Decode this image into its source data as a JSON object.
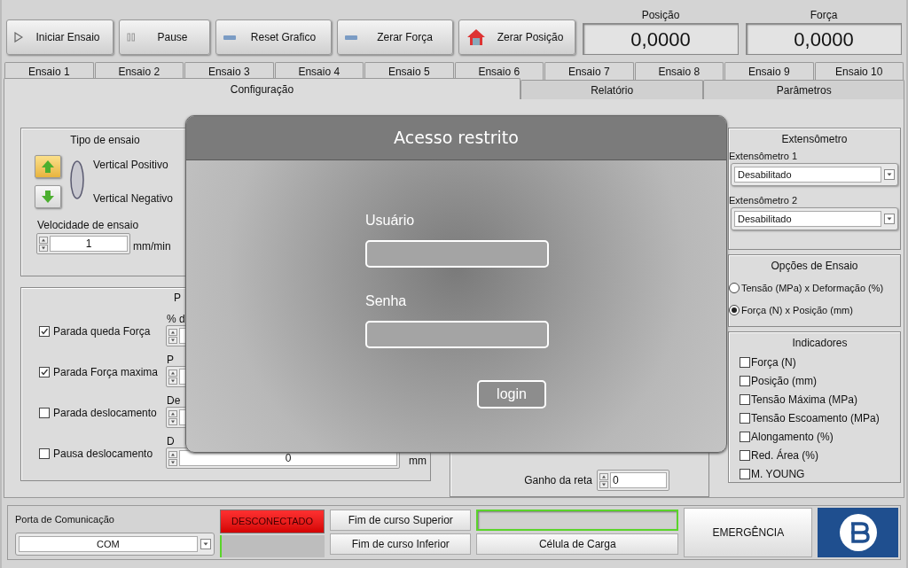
{
  "toolbar": {
    "buttons": [
      {
        "label": "Iniciar Ensaio",
        "kind": "play"
      },
      {
        "label": "Pause",
        "kind": "pause"
      },
      {
        "label": "Reset Grafico",
        "kind": "dash"
      },
      {
        "label": "Zerar Força",
        "kind": "dash"
      },
      {
        "label": "Zerar Posição",
        "kind": "home"
      }
    ],
    "readouts": [
      {
        "label": "Posição",
        "value": "0,0000"
      },
      {
        "label": "Força",
        "value": "0,0000"
      }
    ]
  },
  "test_tabs": [
    {
      "label": "Ensaio 1",
      "selected": false
    },
    {
      "label": "Ensaio 2",
      "selected": false
    },
    {
      "label": "Ensaio 3",
      "selected": false
    },
    {
      "label": "Ensaio 4",
      "selected": false
    },
    {
      "label": "Ensaio 5",
      "selected": false
    },
    {
      "label": "Ensaio 6",
      "selected": false
    },
    {
      "label": "Ensaio 7",
      "selected": false
    },
    {
      "label": "Ensaio 8",
      "selected": false
    },
    {
      "label": "Ensaio 9",
      "selected": false
    },
    {
      "label": "Ensaio 10",
      "selected": false
    }
  ],
  "section_tabs": [
    {
      "label": "Configuração",
      "selected": true
    },
    {
      "label": "Relatório",
      "selected": false
    },
    {
      "label": "Parâmetros",
      "selected": false
    }
  ],
  "test_type": {
    "title": "Tipo de ensaio",
    "directions": [
      {
        "label": "Vertical Positivo",
        "selected": true
      },
      {
        "label": "Vertical Negativo",
        "selected": false
      }
    ],
    "speed_label": "Velocidade de ensaio",
    "speed_value": "1",
    "speed_unit": "mm/min"
  },
  "stops": {
    "title": "P",
    "rows": [
      {
        "label": "Parada queda Força",
        "checked": true,
        "caption": "% d"
      },
      {
        "label": "Parada Força maxima",
        "checked": true,
        "caption": "P"
      },
      {
        "label": "Parada deslocamento",
        "checked": false,
        "caption": "De"
      },
      {
        "label": "Pausa deslocamento",
        "checked": false,
        "caption": "D",
        "value": "0",
        "unit": "mm"
      }
    ]
  },
  "line_gain": {
    "label": "Ganho da reta",
    "value": "0"
  },
  "extensometer": {
    "title": "Extensômetro",
    "selects": [
      {
        "label": "Extensômetro 1",
        "value": "Desabilitado"
      },
      {
        "label": "Extensômetro 2",
        "value": "Desabilitado"
      }
    ]
  },
  "test_options": {
    "title": "Opções de Ensaio",
    "options": [
      {
        "label": "Tensão (MPa) x Deformação (%)",
        "selected": false
      },
      {
        "label": "Força (N) x Posição (mm)",
        "selected": true
      }
    ]
  },
  "indicators": {
    "title": "Indicadores",
    "items": [
      {
        "label": "Força (N)",
        "checked": false
      },
      {
        "label": "Posição (mm)",
        "checked": false
      },
      {
        "label": "Tensão Máxima (MPa)",
        "checked": false
      },
      {
        "label": "Tensão Escoamento (MPa)",
        "checked": false
      },
      {
        "label": "Alongamento (%)",
        "checked": false
      },
      {
        "label": "Red. Área (%)",
        "checked": false
      },
      {
        "label": "M. YOUNG",
        "checked": false
      }
    ]
  },
  "status_bar": {
    "port_label": "Porta de Comunicação",
    "port_value": "COM",
    "connected": false,
    "connection": "DESCONECTADO",
    "limit_switches": [
      "Fim de curso Superior",
      "Fim de curso Inferior"
    ],
    "load_cell": "Célula de Carga",
    "emergency": "EMERGÊNCIA"
  },
  "login_dialog": {
    "title": "Acesso restrito",
    "fields": [
      {
        "label": "Usuário"
      },
      {
        "label": "Senha"
      }
    ],
    "button": "login"
  }
}
